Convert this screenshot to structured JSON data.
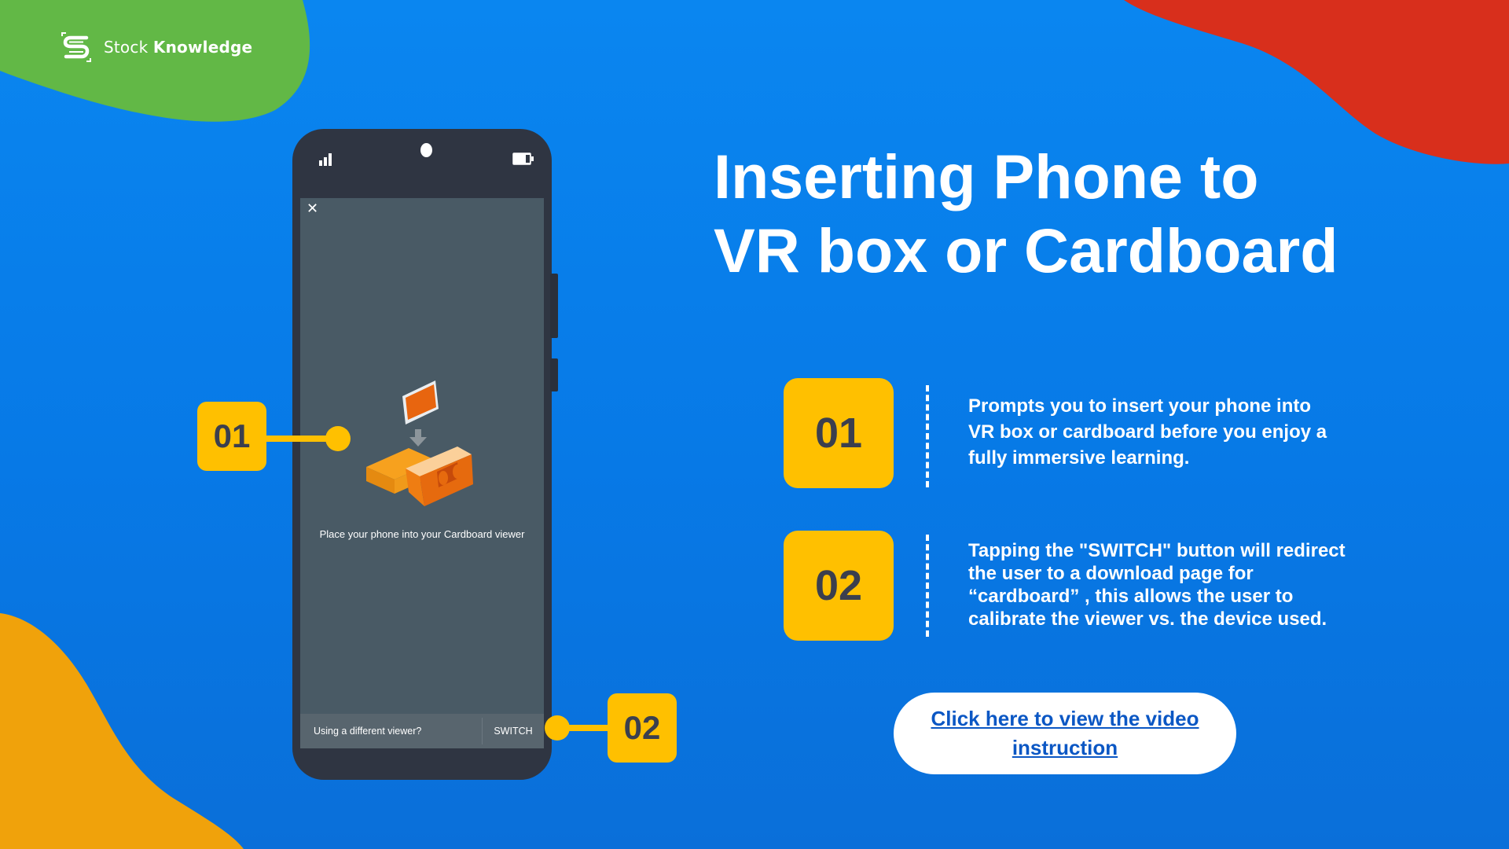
{
  "brand": {
    "name_light": "Stock",
    "name_bold": "Knowledge",
    "logo_icon": "stock-knowledge-logo-icon"
  },
  "title": {
    "line1": "Inserting Phone to",
    "line2": "VR box or Cardboard"
  },
  "phone": {
    "status_icons": [
      "signal-icon",
      "camera-icon",
      "battery-icon"
    ],
    "close_label": "✕",
    "illustration": "cardboard-viewer-illustration",
    "instruction": "Place your phone into your Cardboard viewer",
    "bottom_question": "Using a different viewer?",
    "switch_label": "SWITCH"
  },
  "callouts": [
    "01",
    "02"
  ],
  "steps": [
    {
      "number": "01",
      "text": "Prompts you to insert your phone into VR box or cardboard before you enjoy a fully immersive learning."
    },
    {
      "number": "02",
      "text": "Tapping the \"SWITCH\" button will redirect the user to a download page for “cardboard” , this allows the user to calibrate the viewer vs. the device used."
    }
  ],
  "cta": {
    "label": "Click here to view the video instruction"
  },
  "colors": {
    "background": "#0779e6",
    "accent_yellow": "#ffc000",
    "blob_green": "#62b846",
    "blob_red": "#d82f1c",
    "blob_orange": "#f0a20b",
    "link_blue": "#0b57c4"
  }
}
